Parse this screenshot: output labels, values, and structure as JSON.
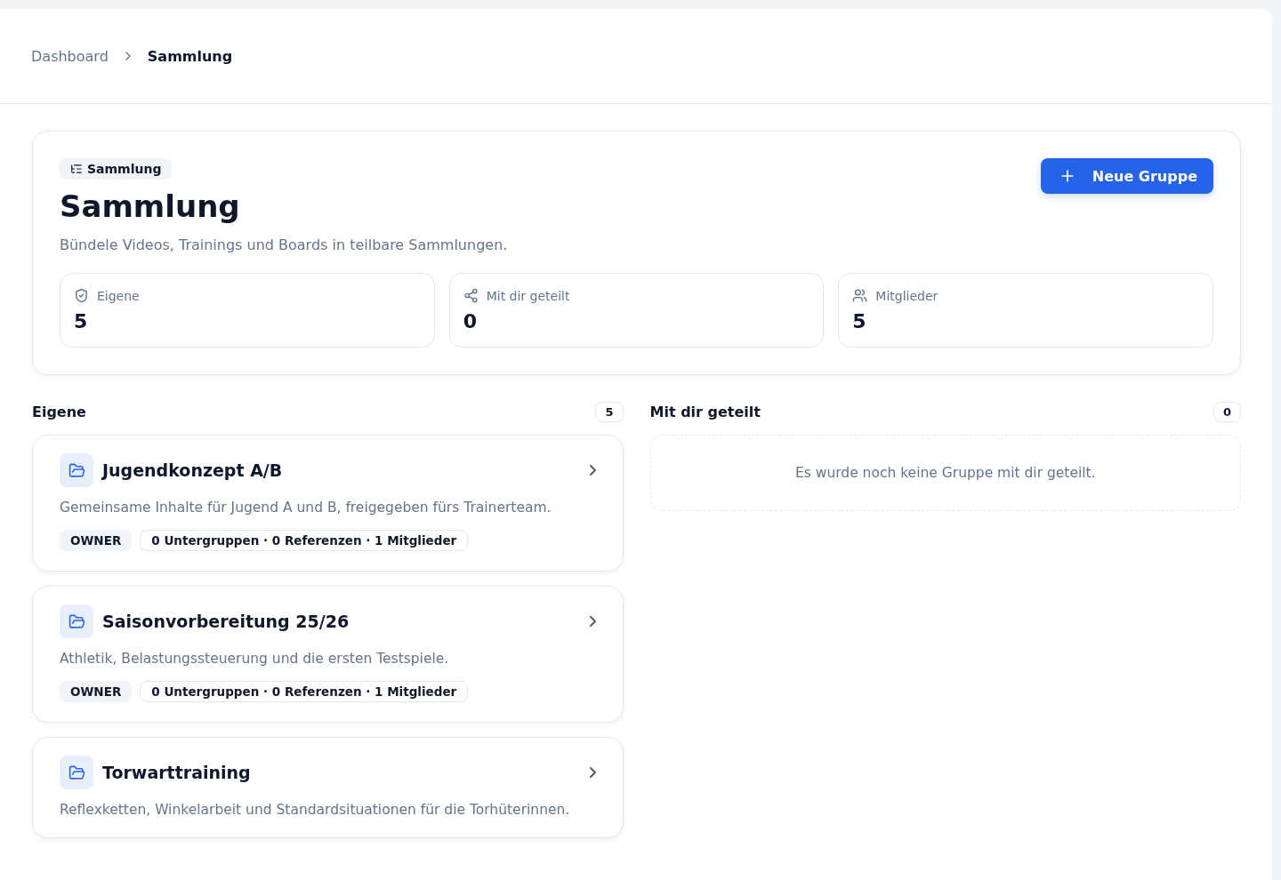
{
  "breadcrumb": [
    {
      "label": "Dashboard",
      "current": false
    },
    {
      "label": "Sammlung",
      "current": true
    }
  ],
  "hero": {
    "badge": "Sammlung",
    "title": "Sammlung",
    "subtitle": "Bündele Videos, Trainings und Boards in teilbare Sammlungen.",
    "button": "Neue Gruppe"
  },
  "stats": [
    {
      "kind": "shield",
      "label": "Eigene",
      "value": "5"
    },
    {
      "kind": "share",
      "label": "Mit dir geteilt",
      "value": "0"
    },
    {
      "kind": "users",
      "label": "Mitglieder",
      "value": "5"
    }
  ],
  "own": {
    "title": "Eigene",
    "count": "5",
    "groups": [
      {
        "name": "Jugendkonzept A/B",
        "description": "Gemeinsame Inhalte für Jugend A und B, freigegeben fürs Trainerteam.",
        "role": "OWNER",
        "meta": "0 Untergruppen · 0 Referenzen · 1 Mitglieder"
      },
      {
        "name": "Saisonvorbereitung 25/26",
        "description": "Athletik, Belastungssteuerung und die ersten Testspiele.",
        "role": "OWNER",
        "meta": "0 Untergruppen · 0 Referenzen · 1 Mitglieder"
      },
      {
        "name": "Torwarttraining",
        "description": "Reflexketten, Winkelarbeit und Standardsituationen für die Torhüterinnen."
      }
    ]
  },
  "shared": {
    "title": "Mit dir geteilt",
    "count": "0",
    "empty": "Es wurde noch keine Gruppe mit dir geteilt."
  }
}
